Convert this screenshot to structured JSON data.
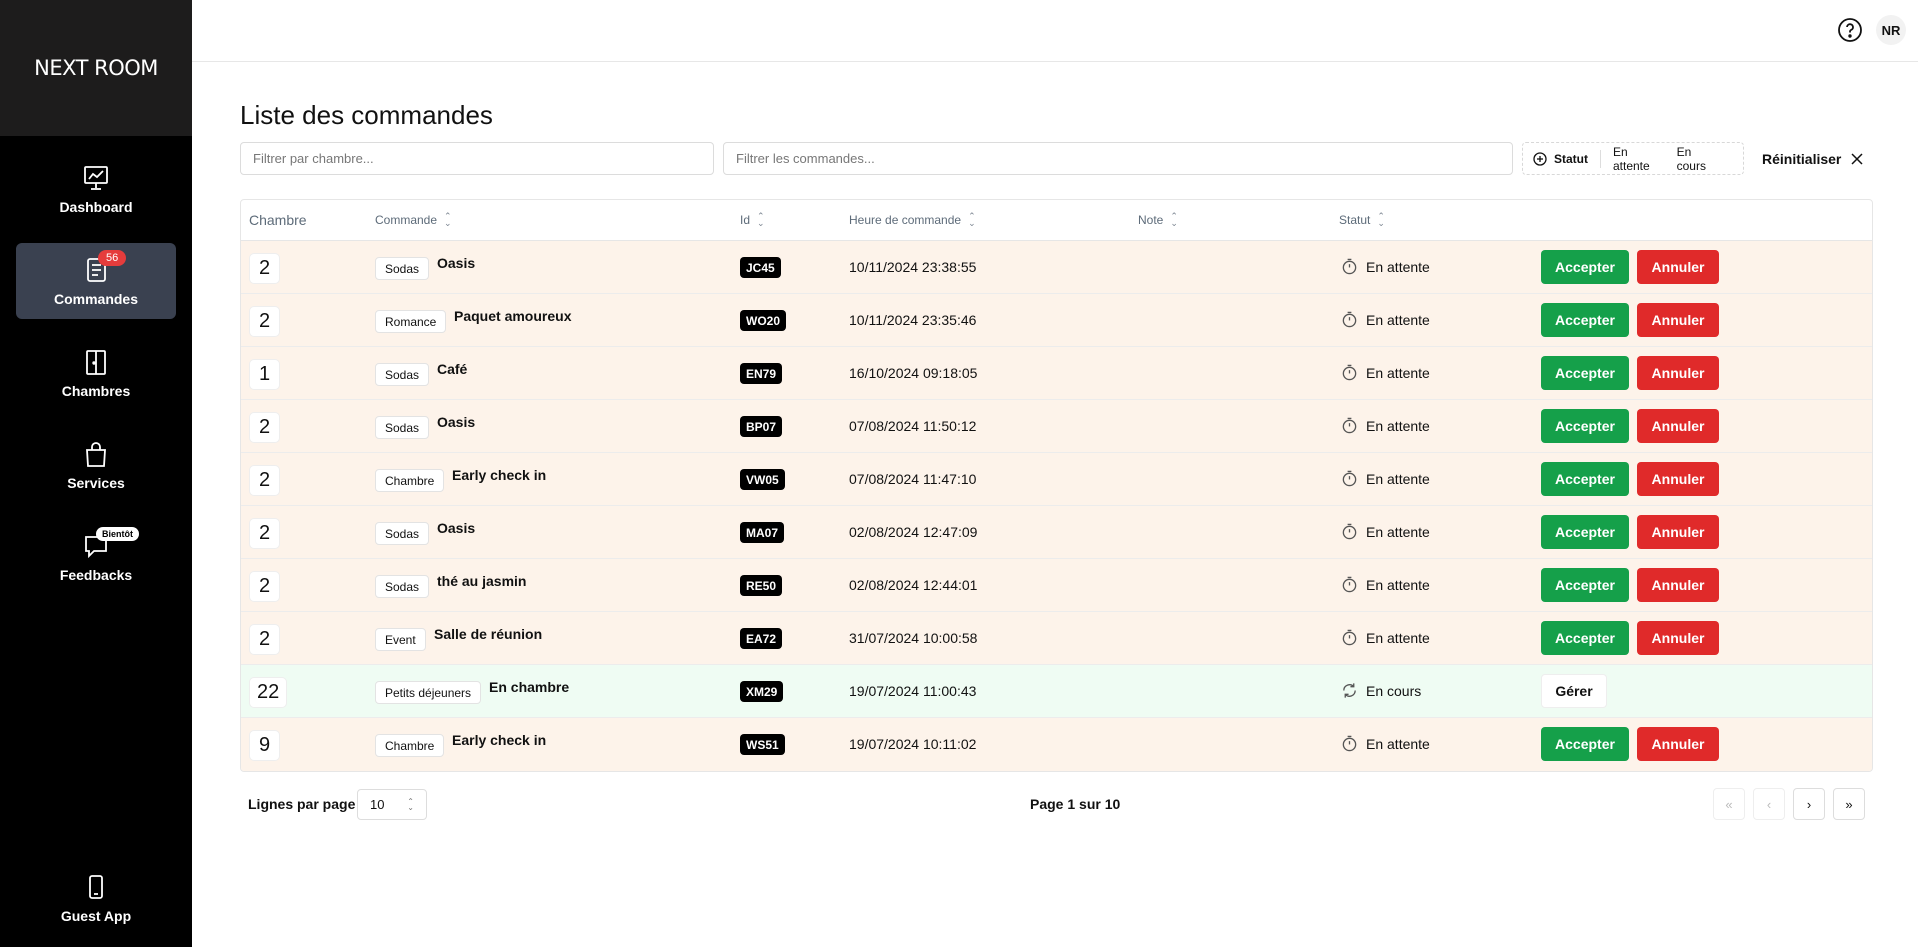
{
  "brand": "NEXT ROOM",
  "sidebar": {
    "items": [
      {
        "label": "Dashboard",
        "icon": "chart-icon"
      },
      {
        "label": "Commandes",
        "icon": "orders-icon",
        "badge": "56"
      },
      {
        "label": "Chambres",
        "icon": "door-icon"
      },
      {
        "label": "Services",
        "icon": "bag-icon"
      },
      {
        "label": "Feedbacks",
        "icon": "chat-icon",
        "badge": "Bientôt"
      }
    ],
    "guest_app": {
      "label": "Guest App",
      "icon": "phone-icon"
    }
  },
  "topbar": {
    "help_icon": "help-circle-icon",
    "avatar": "NR"
  },
  "page": {
    "title": "Liste des commandes"
  },
  "filters": {
    "room_placeholder": "Filtrer par chambre...",
    "orders_placeholder": "Filtrer les commandes...",
    "status_label": "Statut",
    "status_options": [
      "En attente",
      "En cours"
    ],
    "reset_label": "Réinitialiser"
  },
  "table": {
    "columns": [
      "Chambre",
      "Commande",
      "Id",
      "Heure de commande",
      "Note",
      "Statut"
    ],
    "rows": [
      {
        "room": "2",
        "category": "Sodas",
        "item": "Oasis",
        "id": "JC45",
        "time": "10/11/2024 23:38:55",
        "note": "",
        "status": "En attente",
        "state": "pending"
      },
      {
        "room": "2",
        "category": "Romance",
        "item": "Paquet amoureux",
        "id": "WO20",
        "time": "10/11/2024 23:35:46",
        "note": "",
        "status": "En attente",
        "state": "pending"
      },
      {
        "room": "1",
        "category": "Sodas",
        "item": "Café",
        "id": "EN79",
        "time": "16/10/2024 09:18:05",
        "note": "",
        "status": "En attente",
        "state": "pending"
      },
      {
        "room": "2",
        "category": "Sodas",
        "item": "Oasis",
        "id": "BP07",
        "time": "07/08/2024 11:50:12",
        "note": "",
        "status": "En attente",
        "state": "pending"
      },
      {
        "room": "2",
        "category": "Chambre",
        "item": "Early check in",
        "id": "VW05",
        "time": "07/08/2024 11:47:10",
        "note": "",
        "status": "En attente",
        "state": "pending"
      },
      {
        "room": "2",
        "category": "Sodas",
        "item": "Oasis",
        "id": "MA07",
        "time": "02/08/2024 12:47:09",
        "note": "",
        "status": "En attente",
        "state": "pending"
      },
      {
        "room": "2",
        "category": "Sodas",
        "item": "thé au jasmin",
        "id": "RE50",
        "time": "02/08/2024 12:44:01",
        "note": "",
        "status": "En attente",
        "state": "pending"
      },
      {
        "room": "2",
        "category": "Event",
        "item": "Salle de réunion",
        "id": "EA72",
        "time": "31/07/2024 10:00:58",
        "note": "",
        "status": "En attente",
        "state": "pending"
      },
      {
        "room": "22",
        "category": "Petits déjeuners",
        "item": "En chambre",
        "id": "XM29",
        "time": "19/07/2024 11:00:43",
        "note": "",
        "status": "En cours",
        "state": "inprogress"
      },
      {
        "room": "9",
        "category": "Chambre",
        "item": "Early check in",
        "id": "WS51",
        "time": "19/07/2024 10:11:02",
        "note": "",
        "status": "En attente",
        "state": "pending"
      }
    ],
    "accept_label": "Accepter",
    "cancel_label": "Annuler",
    "manage_label": "Gérer"
  },
  "pagination": {
    "rows_per_page_label": "Lignes par page",
    "rows_per_page": "10",
    "page_info": "Page 1 sur 10"
  },
  "colors": {
    "accept": "#15a04a",
    "cancel": "#e02a2a",
    "pending_row": "#fdf3ea",
    "inprogress_row": "#effcf3",
    "badge": "#e53c3c"
  }
}
